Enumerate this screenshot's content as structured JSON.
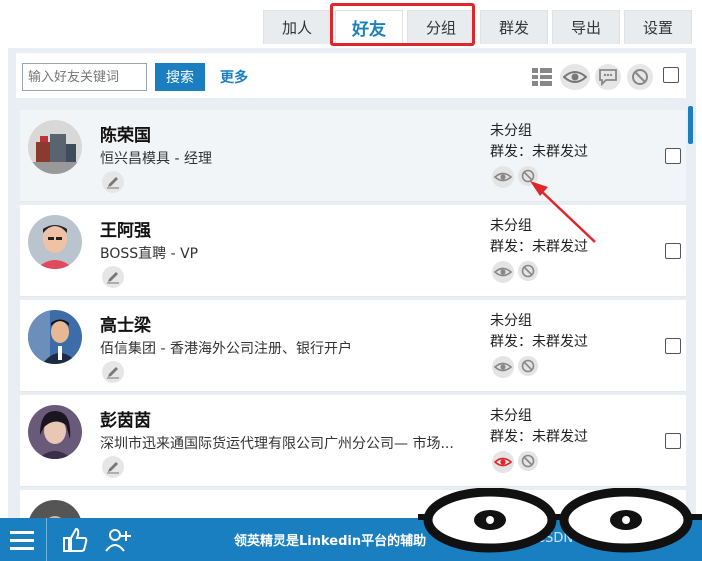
{
  "tabs": [
    {
      "label": "加人",
      "active": false
    },
    {
      "label": "好友",
      "active": true
    },
    {
      "label": "分组",
      "active": false
    },
    {
      "label": "群发",
      "active": false
    },
    {
      "label": "导出",
      "active": false
    },
    {
      "label": "设置",
      "active": false
    }
  ],
  "toolbar": {
    "search_placeholder": "输入好友关键词",
    "search_label": "搜索",
    "more_label": "更多"
  },
  "contacts": [
    {
      "name": "陈荣国",
      "company": "恒兴昌模具 - 经理",
      "group": "未分组",
      "message_status": "群发：未群发过",
      "viewed": false
    },
    {
      "name": "王阿强",
      "company": "BOSS直聘 - VP",
      "group": "未分组",
      "message_status": "群发：未群发过",
      "viewed": false
    },
    {
      "name": "高士梁",
      "company": "佰信集团 - 香港海外公司注册、银行开户",
      "group": "未分组",
      "message_status": "群发：未群发过",
      "viewed": false
    },
    {
      "name": "彭茵茵",
      "company": "深圳市迅来通国际货运代理有限公司广州分公司— 市场...",
      "group": "未分组",
      "message_status": "群发：未群发过",
      "viewed": true
    }
  ],
  "footer": {
    "banner": "领英精灵是Linkedin平台的辅助",
    "watermark": "CSDN @QIJIALE01"
  },
  "colors": {
    "accent": "#1a7fc1",
    "highlight": "#e0262a",
    "viewed_eye": "#e0262a"
  },
  "icons": [
    "grid-icon",
    "eye-icon",
    "chat-icon",
    "ban-icon",
    "edit-icon",
    "menu-icon",
    "thumbs-up-icon",
    "add-user-icon"
  ]
}
